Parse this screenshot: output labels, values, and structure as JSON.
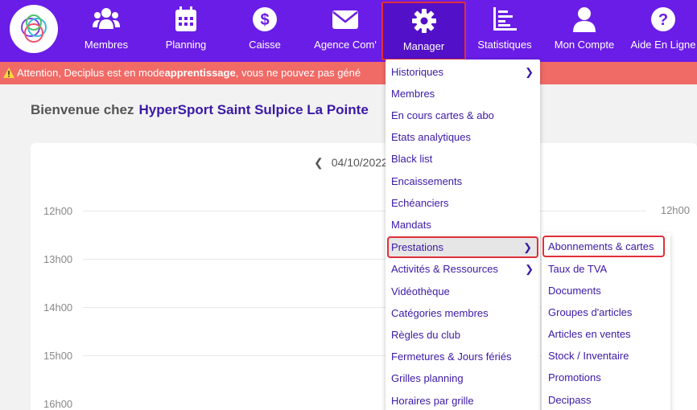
{
  "nav": {
    "items": [
      {
        "label": "Membres",
        "icon": "users-icon"
      },
      {
        "label": "Planning",
        "icon": "calendar-icon"
      },
      {
        "label": "Caisse",
        "icon": "dollar-icon"
      },
      {
        "label": "Agence Com'",
        "icon": "envelope-icon"
      },
      {
        "label": "Manager",
        "icon": "gear-icon"
      },
      {
        "label": "Statistiques",
        "icon": "chart-icon"
      },
      {
        "label": "Mon Compte",
        "icon": "user-icon"
      },
      {
        "label": "Aide En Ligne",
        "icon": "help-icon"
      }
    ],
    "active": "Manager"
  },
  "alert": {
    "prefix": "Attention, Deciplus est en mode",
    "bold": "apprentissage",
    "suffix": ", vous ne pouvez pas géné"
  },
  "welcome": {
    "label": "Bienvenue chez",
    "club": "HyperSport Saint Sulpice La Pointe"
  },
  "calendar": {
    "date": "04/10/2022",
    "hours": [
      "12h00",
      "13h00",
      "14h00",
      "15h00",
      "16h00"
    ],
    "right_hour": "12h00"
  },
  "manager_menu": {
    "items": [
      {
        "label": "Historiques",
        "has_submenu": true
      },
      {
        "label": "Membres"
      },
      {
        "label": "En cours cartes & abo"
      },
      {
        "label": "Etats analytiques"
      },
      {
        "label": "Black list"
      },
      {
        "label": "Encaissements"
      },
      {
        "label": "Echéanciers"
      },
      {
        "label": "Mandats"
      },
      {
        "label": "Prestations",
        "has_submenu": true,
        "highlighted": true
      },
      {
        "label": "Activités & Ressources",
        "has_submenu": true
      },
      {
        "label": "Vidéothèque"
      },
      {
        "label": "Catégories membres"
      },
      {
        "label": "Règles du club"
      },
      {
        "label": "Fermetures & Jours fériés"
      },
      {
        "label": "Grilles planning"
      },
      {
        "label": "Horaires par grille"
      }
    ]
  },
  "prestations_submenu": {
    "items": [
      {
        "label": "Abonnements & cartes",
        "highlighted": true
      },
      {
        "label": "Taux de TVA"
      },
      {
        "label": "Documents"
      },
      {
        "label": "Groupes d'articles"
      },
      {
        "label": "Articles en ventes"
      },
      {
        "label": "Stock / Inventaire"
      },
      {
        "label": "Promotions"
      },
      {
        "label": "Decipass"
      }
    ]
  },
  "colors": {
    "brand": "#6a1de6",
    "alert": "#f06a66",
    "link": "#3b19a6",
    "highlight_border": "#e0303a"
  }
}
